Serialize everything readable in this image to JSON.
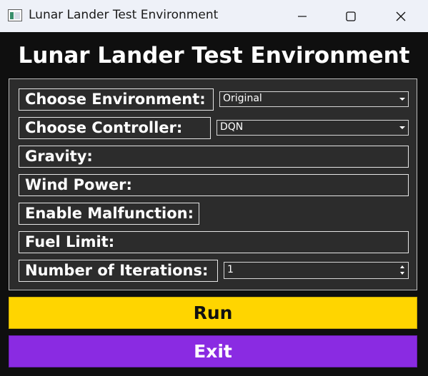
{
  "window": {
    "title": "Lunar Lander Test Environment"
  },
  "app": {
    "heading": "Lunar Lander Test Environment"
  },
  "form": {
    "environment": {
      "label": "Choose Environment:",
      "value": "Original"
    },
    "controller": {
      "label": "Choose Controller:",
      "value": "DQN"
    },
    "gravity": {
      "label": "Gravity:"
    },
    "wind_power": {
      "label": "Wind Power:"
    },
    "malfunction": {
      "label": "Enable Malfunction:"
    },
    "fuel_limit": {
      "label": "Fuel Limit:"
    },
    "iterations": {
      "label": "Number of Iterations:",
      "value": "1"
    }
  },
  "buttons": {
    "run": "Run",
    "exit": "Exit"
  },
  "colors": {
    "run_bg": "#ffd500",
    "exit_bg": "#8a2be2",
    "panel_bg": "#2c2c2c"
  },
  "icons": {
    "app": "app-window-icon",
    "minimize": "minimize-icon",
    "maximize": "maximize-icon",
    "close": "close-icon"
  }
}
